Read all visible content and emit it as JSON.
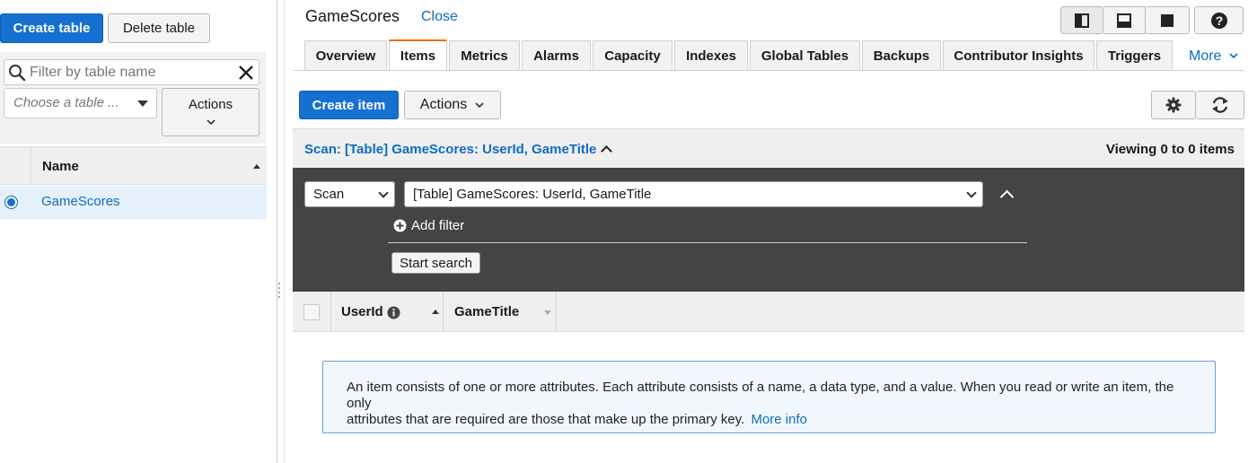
{
  "left_panel": {
    "create_table_label": "Create table",
    "delete_table_label": "Delete table",
    "filter_placeholder": "Filter by table name",
    "table_select_placeholder": "Choose a table ...",
    "actions_label": "Actions",
    "column_name": "Name",
    "tables": [
      {
        "name": "GameScores",
        "selected": true
      }
    ]
  },
  "header": {
    "table_title": "GameScores",
    "close_label": "Close",
    "view_icons": [
      "split-vertical-icon",
      "split-horizontal-icon",
      "full-panel-icon"
    ],
    "help_icon": "help-icon"
  },
  "tabs": [
    {
      "label": "Overview",
      "active": false
    },
    {
      "label": "Items",
      "active": true
    },
    {
      "label": "Metrics",
      "active": false
    },
    {
      "label": "Alarms",
      "active": false
    },
    {
      "label": "Capacity",
      "active": false
    },
    {
      "label": "Indexes",
      "active": false
    },
    {
      "label": "Global Tables",
      "active": false
    },
    {
      "label": "Backups",
      "active": false
    },
    {
      "label": "Contributor Insights",
      "active": false
    },
    {
      "label": "Triggers",
      "active": false
    }
  ],
  "more_label": "More",
  "items_toolbar": {
    "create_item_label": "Create item",
    "actions_label": "Actions",
    "settings_icon": "gear-icon",
    "refresh_icon": "refresh-icon"
  },
  "scan": {
    "summary": "Scan: [Table] GameScores: UserId, GameTitle",
    "viewing": "Viewing 0 to 0 items",
    "mode_value": "Scan",
    "target_value": "[Table] GameScores: UserId, GameTitle",
    "add_filter_label": "Add filter",
    "start_search_label": "Start search"
  },
  "grid": {
    "columns": [
      "UserId",
      "GameTitle"
    ]
  },
  "info": {
    "text_line1": "An item consists of one or more attributes. Each attribute consists of a name, a data type, and a value. When you read or write an item, the only",
    "text_line2": "attributes that are required are those that make up the primary key.",
    "more_info_label": "More info"
  },
  "colors": {
    "primary": "#1570d2",
    "active_tab": "#ec7211",
    "link": "#0f6cc1",
    "dark_panel": "#444444"
  }
}
